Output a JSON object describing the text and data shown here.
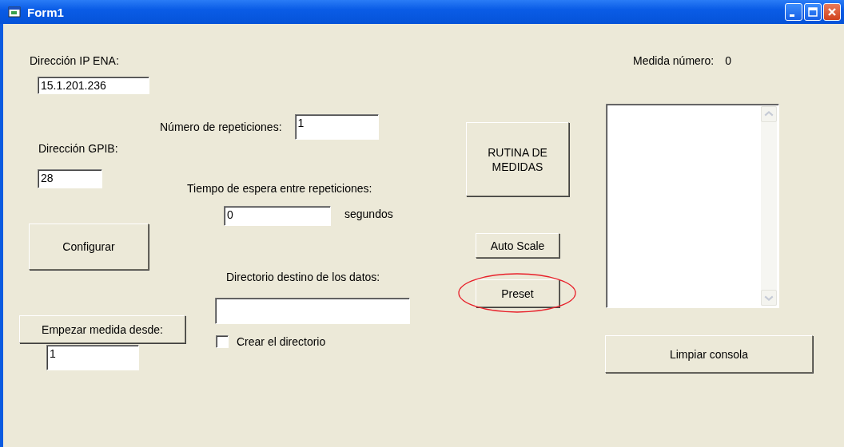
{
  "window": {
    "title": "Form1"
  },
  "ip": {
    "label": "Dirección IP ENA:",
    "value": "15.1.201.236"
  },
  "gpib": {
    "label": "Dirección GPIB:",
    "value": "28"
  },
  "configure_button": {
    "label": "Configurar"
  },
  "start_from": {
    "button": {
      "label": "Empezar medida desde:"
    },
    "value": "1"
  },
  "repetitions": {
    "label": "Número de repeticiones:",
    "value": "1"
  },
  "wait": {
    "label": "Tiempo de espera entre repeticiones:",
    "value": "0",
    "unit": "segundos"
  },
  "directory": {
    "label": "Directorio destino de los datos:",
    "checkbox": {
      "label": "Crear el directorio",
      "checked": false
    }
  },
  "actions": [
    {
      "label": "RUTINA DE MEDIDAS",
      "circled": false
    },
    {
      "label": "Auto Scale",
      "circled": false
    },
    {
      "label": "Preset",
      "circled": true
    }
  ],
  "measure": {
    "label": "Medida número:",
    "value": "0"
  },
  "clear_button": {
    "label": "Limpiar consola"
  }
}
